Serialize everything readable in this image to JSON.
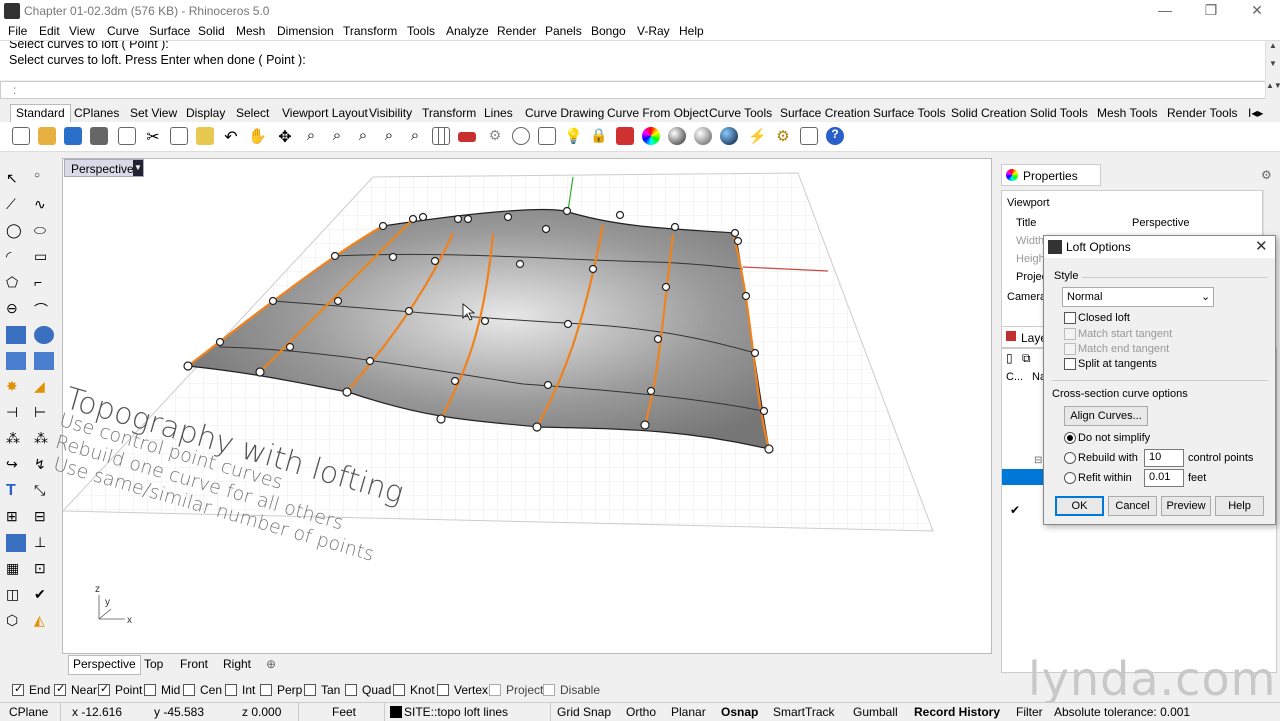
{
  "window": {
    "title": "Chapter 01-02.3dm (576 KB) - Rhinoceros 5.0"
  },
  "menu": [
    "File",
    "Edit",
    "View",
    "Curve",
    "Surface",
    "Solid",
    "Mesh",
    "Dimension",
    "Transform",
    "Tools",
    "Analyze",
    "Render",
    "Panels",
    "Bongo",
    "V-Ray",
    "Help"
  ],
  "command": {
    "history_line1": "Select curves to loft ( Point ):",
    "history_line2": "Select curves to loft. Press Enter when done ( Point ):",
    "prompt": ":"
  },
  "toolbar_tabs": [
    "Standard",
    "CPlanes",
    "Set View",
    "Display",
    "Select",
    "Viewport Layout",
    "Visibility",
    "Transform",
    "Lines",
    "Curve Drawing",
    "Curve From Object",
    "Curve Tools",
    "Surface Creation",
    "Surface Tools",
    "Solid Creation",
    "Solid Tools",
    "Mesh Tools",
    "Render Tools"
  ],
  "viewport": {
    "label": "Perspective",
    "text_title": "Topography with lofting",
    "text_lines": [
      "Use control point curves",
      "Rebuild one curve for all others",
      "Use same/similar number of points"
    ],
    "tabs": [
      "Perspective",
      "Top",
      "Front",
      "Right"
    ]
  },
  "properties": {
    "tab": "Properties",
    "section": "Viewport",
    "rows": [
      {
        "label": "Title",
        "value": "Perspective"
      },
      {
        "label": "Width",
        "value": ""
      },
      {
        "label": "Height",
        "value": ""
      },
      {
        "label": "Projection",
        "value": ""
      },
      {
        "label": "Camera",
        "value": ""
      }
    ],
    "layers_tab": "Layers",
    "layers_col_c": "C...",
    "layers_col_n": "Na"
  },
  "dialog": {
    "title": "Loft Options",
    "style_label": "Style",
    "style_value": "Normal",
    "closed_loft": "Closed loft",
    "match_start": "Match start tangent",
    "match_end": "Match end tangent",
    "split_tangents": "Split at tangents",
    "cross_label": "Cross-section curve options",
    "align_button": "Align Curves...",
    "do_not_simplify": "Do not simplify",
    "rebuild_with": "Rebuild with",
    "rebuild_value": "10",
    "rebuild_unit": "control points",
    "refit_within": "Refit within",
    "refit_value": "0.01",
    "refit_unit": "feet",
    "ok": "OK",
    "cancel": "Cancel",
    "preview": "Preview",
    "help": "Help"
  },
  "osnap": [
    {
      "label": "End",
      "checked": true
    },
    {
      "label": "Near",
      "checked": true
    },
    {
      "label": "Point",
      "checked": true
    },
    {
      "label": "Mid",
      "checked": false
    },
    {
      "label": "Cen",
      "checked": false
    },
    {
      "label": "Int",
      "checked": false
    },
    {
      "label": "Perp",
      "checked": false
    },
    {
      "label": "Tan",
      "checked": false
    },
    {
      "label": "Quad",
      "checked": false
    },
    {
      "label": "Knot",
      "checked": false
    },
    {
      "label": "Vertex",
      "checked": false
    },
    {
      "label": "Project",
      "checked": false
    },
    {
      "label": "Disable",
      "checked": false
    }
  ],
  "status": {
    "cplane": "CPlane",
    "x": "x -12.616",
    "y": "y -45.583",
    "z": "z 0.000",
    "units": "Feet",
    "layer": "SITE::topo loft lines",
    "grid_snap": "Grid Snap",
    "ortho": "Ortho",
    "planar": "Planar",
    "osnap": "Osnap",
    "smarttrack": "SmartTrack",
    "gumball": "Gumball",
    "record_history": "Record History",
    "filter": "Filter",
    "tolerance": "Absolute tolerance: 0.001"
  },
  "watermark": "lynda.com",
  "colors": {
    "curve": "#f0821e",
    "surface": "#8a8a8a",
    "accent": "#0078d7"
  }
}
